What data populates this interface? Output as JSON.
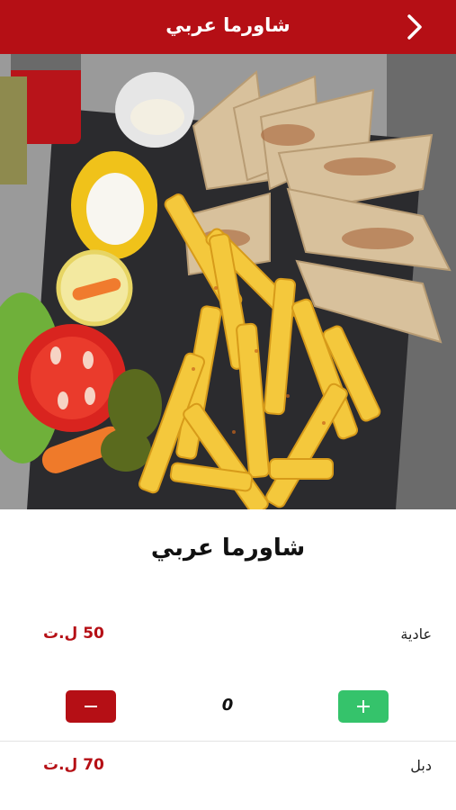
{
  "header": {
    "title": "شاورما عربي",
    "back_icon": "chevron-right-icon",
    "bg_color": "#b50f15"
  },
  "hero": {
    "image": "food-photo",
    "carousel_active_dot": 1
  },
  "dish": {
    "name": "شاورما عربي"
  },
  "options": [
    {
      "label": "عادية",
      "price": "50 ل.ت",
      "quantity": "0"
    },
    {
      "label": "دبل",
      "price": "70 ل.ت"
    }
  ],
  "colors": {
    "accent": "#b50f15",
    "add_button": "#35c36b"
  }
}
